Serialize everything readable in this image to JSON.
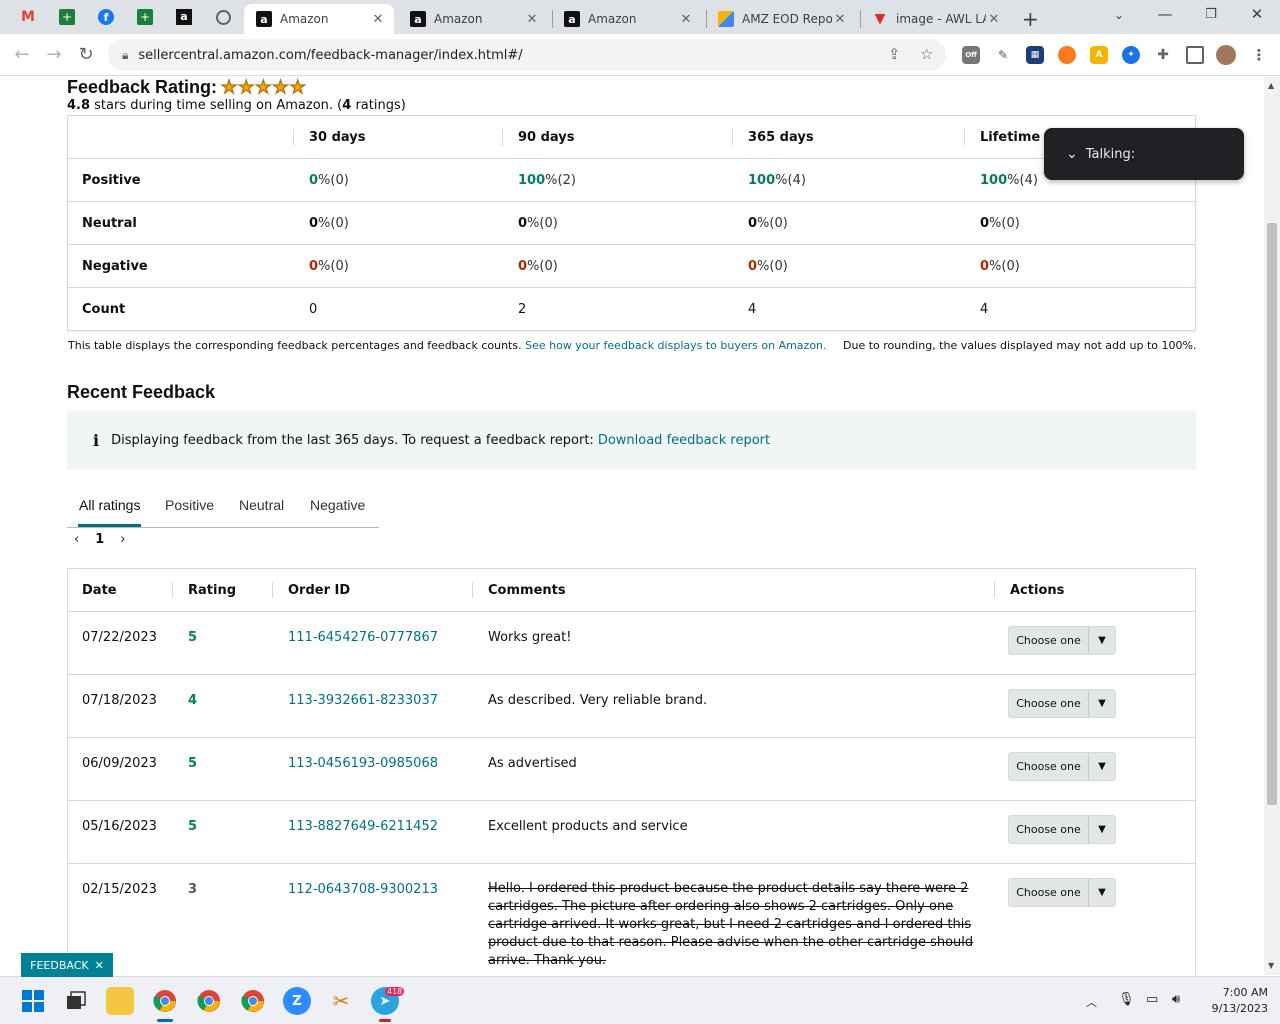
{
  "browser": {
    "tabs": [
      {
        "label": "Amazon",
        "active": true
      },
      {
        "label": "Amazon",
        "active": false
      },
      {
        "label": "Amazon",
        "active": false
      },
      {
        "label": "AMZ EOD Repor",
        "active": false
      },
      {
        "label": "image - AWL LA",
        "active": false
      }
    ],
    "url": "sellercentral.amazon.com/feedback-manager/index.html#/"
  },
  "rating": {
    "title": "Feedback Rating:",
    "stars": "★★★★★",
    "stars_value": 4.8,
    "score": "4.8",
    "summary_text": " stars during time selling on Amazon. (",
    "ratings_count": "4",
    "ratings_suffix": " ratings)"
  },
  "summary_table": {
    "columns": [
      "30 days",
      "90 days",
      "365 days",
      "Lifetime"
    ],
    "rows": [
      {
        "label": "Positive",
        "color": "#067d62",
        "cells": [
          {
            "num": "0",
            "rest": " %(0)"
          },
          {
            "num": "100",
            "rest": " %(2)"
          },
          {
            "num": "100",
            "rest": " %(4)"
          },
          {
            "num": "100",
            "rest": " %(4)"
          }
        ]
      },
      {
        "label": "Neutral",
        "color": "#0f1111",
        "cells": [
          {
            "num": "0",
            "rest": " %(0)"
          },
          {
            "num": "0",
            "rest": " %(0)"
          },
          {
            "num": "0",
            "rest": " %(0)"
          },
          {
            "num": "0",
            "rest": " %(0)"
          }
        ]
      },
      {
        "label": "Negative",
        "color": "#b12704",
        "cells": [
          {
            "num": "0",
            "rest": " %(0)"
          },
          {
            "num": "0",
            "rest": " %(0)"
          },
          {
            "num": "0",
            "rest": " %(0)"
          },
          {
            "num": "0",
            "rest": " %(0)"
          }
        ]
      },
      {
        "label": "Count",
        "color": "#0f1111",
        "cells": [
          {
            "num": "",
            "rest": "0"
          },
          {
            "num": "",
            "rest": "2"
          },
          {
            "num": "",
            "rest": "4"
          },
          {
            "num": "",
            "rest": "4"
          }
        ]
      }
    ],
    "note": "This table displays the corresponding feedback percentages and feedback counts. ",
    "note_link": "See how your feedback displays to buyers on Amazon.",
    "rounding_note": "Due to rounding, the values displayed may not add up to 100%."
  },
  "recent": {
    "title": "Recent Feedback",
    "info_text": "Displaying feedback from the last 365 days. To request a feedback report: ",
    "info_link": "Download feedback report",
    "filter_tabs": [
      "All ratings",
      "Positive",
      "Neutral",
      "Negative"
    ],
    "page": "1",
    "columns": [
      "Date",
      "Rating",
      "Order ID",
      "Comments",
      "Actions"
    ],
    "rows": [
      {
        "date": "07/22/2023",
        "rating": "5",
        "order_id": "111-6454276-0777867",
        "comment": "Works great!",
        "action": "Choose one",
        "struck": false
      },
      {
        "date": "07/18/2023",
        "rating": "4",
        "order_id": "113-3932661-8233037",
        "comment": "As described. Very reliable brand.",
        "action": "Choose one",
        "struck": false
      },
      {
        "date": "06/09/2023",
        "rating": "5",
        "order_id": "113-0456193-0985068",
        "comment": "As advertised",
        "action": "Choose one",
        "struck": false
      },
      {
        "date": "05/16/2023",
        "rating": "5",
        "order_id": "113-8827649-6211452",
        "comment": "Excellent products and service",
        "action": "Choose one",
        "struck": false
      },
      {
        "date": "02/15/2023",
        "rating": "3",
        "order_id": "112-0643708-9300213",
        "comment": "Hello. I ordered this product because the product details say there were 2 cartridges. The picture after ordering also shows 2 cartridges. Only one cartridge arrived. It works great, but I need 2 cartridges and I ordered this product due to that reason. Please advise when the other cartridge should arrive. Thank you.",
        "action": "Choose one",
        "struck": true
      }
    ]
  },
  "overlay": {
    "talking": "Talking:"
  },
  "feedback_badge": "FEEDBACK",
  "taskbar": {
    "time": "7:00 AM",
    "date": "9/13/2023",
    "telegram_badge": "418"
  },
  "colors": {
    "link": "#007185",
    "positive": "#067d62",
    "negative": "#b12704",
    "accent": "#008296"
  }
}
